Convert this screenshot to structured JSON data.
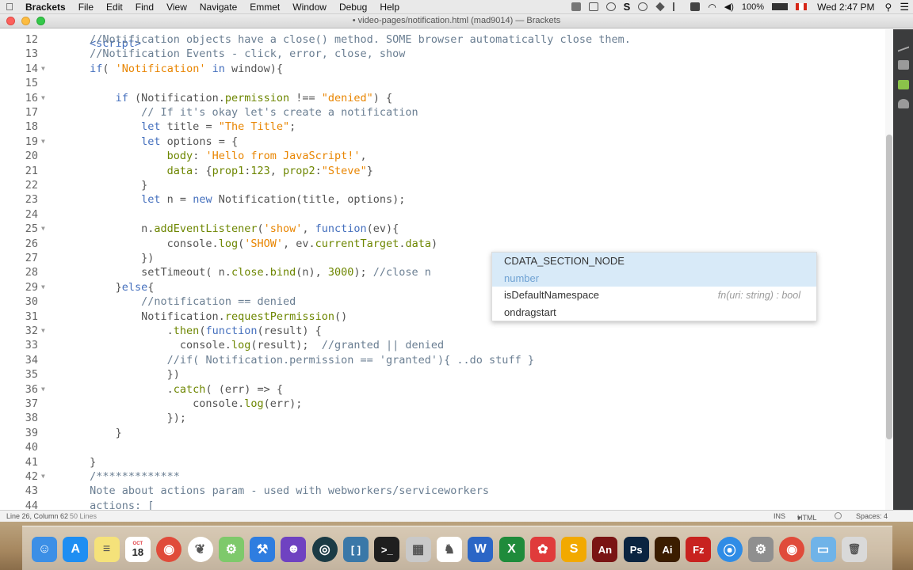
{
  "menubar": {
    "app": "Brackets",
    "items": [
      "File",
      "Edit",
      "Find",
      "View",
      "Navigate",
      "Emmet",
      "Window",
      "Debug",
      "Help"
    ],
    "status": {
      "battery": "100%",
      "clock": "Wed 2:47 PM"
    }
  },
  "window": {
    "title": "• video-pages/notification.html (mad9014) — Brackets"
  },
  "editor": {
    "lines": [
      {
        "n": "12",
        "fold": false,
        "seg": [
          [
            " ",
            ""
          ],
          [
            "//Notification objects have a close() method. SOME browser automatically close them.",
            "c-com"
          ]
        ]
      },
      {
        "n": "13",
        "fold": false,
        "seg": [
          [
            " ",
            ""
          ],
          [
            "//Notification Events - click, error, close, show",
            "c-com"
          ]
        ]
      },
      {
        "n": "14",
        "fold": true,
        "seg": [
          [
            " ",
            ""
          ],
          [
            "if",
            "c-kw"
          ],
          [
            "( ",
            ""
          ],
          [
            "'Notification'",
            "c-str"
          ],
          [
            " ",
            ""
          ],
          [
            "in",
            "c-kw"
          ],
          [
            " window){",
            ""
          ]
        ]
      },
      {
        "n": "15",
        "fold": false,
        "seg": []
      },
      {
        "n": "16",
        "fold": true,
        "seg": [
          [
            "     ",
            ""
          ],
          [
            "if",
            "c-kw"
          ],
          [
            " (Notification.",
            ""
          ],
          [
            "permission",
            "c-prop"
          ],
          [
            " !== ",
            ""
          ],
          [
            "\"denied\"",
            "c-str"
          ],
          [
            ") {",
            ""
          ]
        ]
      },
      {
        "n": "17",
        "fold": false,
        "seg": [
          [
            "         ",
            ""
          ],
          [
            "// If it's okay let's create a notification",
            "c-com"
          ]
        ]
      },
      {
        "n": "18",
        "fold": false,
        "seg": [
          [
            "         ",
            ""
          ],
          [
            "let",
            "c-kw"
          ],
          [
            " title = ",
            ""
          ],
          [
            "\"The Title\"",
            "c-str"
          ],
          [
            ";",
            ""
          ]
        ]
      },
      {
        "n": "19",
        "fold": true,
        "seg": [
          [
            "         ",
            ""
          ],
          [
            "let",
            "c-kw"
          ],
          [
            " options = {",
            ""
          ]
        ]
      },
      {
        "n": "20",
        "fold": false,
        "seg": [
          [
            "             ",
            ""
          ],
          [
            "body",
            "c-prop"
          ],
          [
            ": ",
            ""
          ],
          [
            "'Hello from JavaScript!'",
            "c-str"
          ],
          [
            ",",
            ""
          ]
        ]
      },
      {
        "n": "21",
        "fold": false,
        "seg": [
          [
            "             ",
            ""
          ],
          [
            "data",
            "c-prop"
          ],
          [
            ": {",
            ""
          ],
          [
            "prop1",
            "c-prop"
          ],
          [
            ":",
            ""
          ],
          [
            "123",
            "c-num"
          ],
          [
            ", ",
            ""
          ],
          [
            "prop2",
            "c-prop"
          ],
          [
            ":",
            ""
          ],
          [
            "\"Steve\"",
            "c-str"
          ],
          [
            "}",
            ""
          ]
        ]
      },
      {
        "n": "22",
        "fold": false,
        "seg": [
          [
            "         }",
            ""
          ]
        ]
      },
      {
        "n": "23",
        "fold": false,
        "seg": [
          [
            "         ",
            ""
          ],
          [
            "let",
            "c-kw"
          ],
          [
            " n = ",
            ""
          ],
          [
            "new",
            "c-kw"
          ],
          [
            " Notification(title, options);",
            ""
          ]
        ]
      },
      {
        "n": "24",
        "fold": false,
        "seg": []
      },
      {
        "n": "25",
        "fold": true,
        "seg": [
          [
            "         n.",
            ""
          ],
          [
            "addEventListener",
            "c-prop"
          ],
          [
            "(",
            ""
          ],
          [
            "'show'",
            "c-str"
          ],
          [
            ", ",
            ""
          ],
          [
            "function",
            "c-kw"
          ],
          [
            "(ev){",
            ""
          ]
        ]
      },
      {
        "n": "26",
        "fold": false,
        "seg": [
          [
            "             console.",
            ""
          ],
          [
            "log",
            "c-prop"
          ],
          [
            "(",
            ""
          ],
          [
            "'SHOW'",
            "c-str"
          ],
          [
            ", ev.",
            ""
          ],
          [
            "currentTarget",
            "c-prop"
          ],
          [
            ".",
            ""
          ],
          [
            "data",
            "c-prop"
          ],
          [
            ")",
            ""
          ]
        ]
      },
      {
        "n": "27",
        "fold": false,
        "seg": [
          [
            "         })",
            ""
          ]
        ]
      },
      {
        "n": "28",
        "fold": false,
        "seg": [
          [
            "         setTimeout( n.",
            ""
          ],
          [
            "close",
            "c-prop"
          ],
          [
            ".",
            ""
          ],
          [
            "bind",
            "c-prop"
          ],
          [
            "(n), ",
            ""
          ],
          [
            "3000",
            "c-num"
          ],
          [
            "); ",
            ""
          ],
          [
            "//close n",
            "c-com"
          ]
        ]
      },
      {
        "n": "29",
        "fold": true,
        "seg": [
          [
            "     }",
            ""
          ],
          [
            "else",
            "c-kw"
          ],
          [
            "{",
            ""
          ]
        ]
      },
      {
        "n": "30",
        "fold": false,
        "seg": [
          [
            "         ",
            ""
          ],
          [
            "//notification == denied",
            "c-com"
          ]
        ]
      },
      {
        "n": "31",
        "fold": false,
        "seg": [
          [
            "         Notification.",
            ""
          ],
          [
            "requestPermission",
            "c-prop"
          ],
          [
            "()",
            ""
          ]
        ]
      },
      {
        "n": "32",
        "fold": true,
        "seg": [
          [
            "             .",
            ""
          ],
          [
            "then",
            "c-prop"
          ],
          [
            "(",
            ""
          ],
          [
            "function",
            "c-kw"
          ],
          [
            "(result) {",
            ""
          ]
        ]
      },
      {
        "n": "33",
        "fold": false,
        "seg": [
          [
            "               console.",
            ""
          ],
          [
            "log",
            "c-prop"
          ],
          [
            "(result);  ",
            ""
          ],
          [
            "//granted || denied",
            "c-com"
          ]
        ]
      },
      {
        "n": "34",
        "fold": false,
        "seg": [
          [
            "             ",
            ""
          ],
          [
            "//if( Notification.permission == 'granted'){ ..do stuff }",
            "c-com"
          ]
        ]
      },
      {
        "n": "35",
        "fold": false,
        "seg": [
          [
            "             })",
            ""
          ]
        ]
      },
      {
        "n": "36",
        "fold": true,
        "seg": [
          [
            "             .",
            ""
          ],
          [
            "catch",
            "c-prop"
          ],
          [
            "( (err) => {",
            ""
          ]
        ]
      },
      {
        "n": "37",
        "fold": false,
        "seg": [
          [
            "                 console.",
            ""
          ],
          [
            "log",
            "c-prop"
          ],
          [
            "(err);",
            ""
          ]
        ]
      },
      {
        "n": "38",
        "fold": false,
        "seg": [
          [
            "             });",
            ""
          ]
        ]
      },
      {
        "n": "39",
        "fold": false,
        "seg": [
          [
            "     }",
            ""
          ]
        ]
      },
      {
        "n": "40",
        "fold": false,
        "seg": []
      },
      {
        "n": "41",
        "fold": false,
        "seg": [
          [
            " }",
            ""
          ]
        ]
      },
      {
        "n": "42",
        "fold": true,
        "seg": [
          [
            " ",
            ""
          ],
          [
            "/*************",
            "c-com"
          ]
        ]
      },
      {
        "n": "43",
        "fold": false,
        "seg": [
          [
            " ",
            ""
          ],
          [
            "Note about actions param - used with webworkers/serviceworkers",
            "c-com"
          ]
        ]
      },
      {
        "n": "44",
        "fold": false,
        "seg": [
          [
            " ",
            ""
          ],
          [
            "actions: [",
            "c-com"
          ]
        ]
      }
    ]
  },
  "code_hints": [
    {
      "name": "CDATA_SECTION_NODE",
      "detail": "number",
      "type": "",
      "selected": true
    },
    {
      "name": "isDefaultNamespace",
      "detail": "",
      "type": "fn(uri: string) : bool",
      "selected": false
    },
    {
      "name": "ondragstart",
      "detail": "",
      "type": "",
      "selected": false
    }
  ],
  "statusbar": {
    "cursor": "Line 26, Column 62",
    "lines": "50 Lines",
    "mode": "INS",
    "language": "HTML",
    "spaces": "Spaces: 4"
  },
  "dock": {
    "calendar": {
      "month": "OCT",
      "day": "18"
    },
    "apps": [
      {
        "name": "finder",
        "color": "#3c8fe6",
        "glyph": "☺"
      },
      {
        "name": "app-store",
        "color": "#1e8ef2",
        "glyph": "A"
      },
      {
        "name": "notes",
        "color": "#f5e27a",
        "glyph": "≡"
      },
      {
        "name": "calendar",
        "color": "#ffffff",
        "glyph": ""
      },
      {
        "name": "chrome",
        "color": "#e04b3a",
        "glyph": "◉"
      },
      {
        "name": "mongodb",
        "color": "#ffffff",
        "glyph": "❦"
      },
      {
        "name": "android-studio",
        "color": "#7ec96b",
        "glyph": "⚙"
      },
      {
        "name": "xcode",
        "color": "#2e7de0",
        "glyph": "⚒"
      },
      {
        "name": "github",
        "color": "#6f42c1",
        "glyph": "☻"
      },
      {
        "name": "gitkraken",
        "color": "#1b3b45",
        "glyph": "◎"
      },
      {
        "name": "brackets",
        "color": "#3a78a8",
        "glyph": "[ ]"
      },
      {
        "name": "terminal",
        "color": "#1f1f1f",
        "glyph": ">_"
      },
      {
        "name": "calculator",
        "color": "#c9c9c9",
        "glyph": "▦"
      },
      {
        "name": "sequel-pro",
        "color": "#ffffff",
        "glyph": "♞"
      },
      {
        "name": "word",
        "color": "#2b66c6",
        "glyph": "W"
      },
      {
        "name": "excel",
        "color": "#1f8b3b",
        "glyph": "X"
      },
      {
        "name": "photo-booth",
        "color": "#e03b3b",
        "glyph": "✿"
      },
      {
        "name": "sketch",
        "color": "#f2a900",
        "glyph": "S"
      },
      {
        "name": "animate",
        "color": "#7a1414",
        "glyph": "An"
      },
      {
        "name": "photoshop",
        "color": "#0b2440",
        "glyph": "Ps"
      },
      {
        "name": "illustrator",
        "color": "#3b1d00",
        "glyph": "Ai"
      },
      {
        "name": "filezilla",
        "color": "#c8221f",
        "glyph": "Fz"
      },
      {
        "name": "safari",
        "color": "#2f8ce6",
        "glyph": "⦿"
      },
      {
        "name": "system-preferences",
        "color": "#8f8f8f",
        "glyph": "⚙"
      },
      {
        "name": "chrome-2",
        "color": "#e04b3a",
        "glyph": "◉"
      },
      {
        "name": "downloads-folder",
        "color": "#6fb3e8",
        "glyph": "▭"
      },
      {
        "name": "trash",
        "color": "#d9d9d9",
        "glyph": "🗑"
      }
    ]
  }
}
